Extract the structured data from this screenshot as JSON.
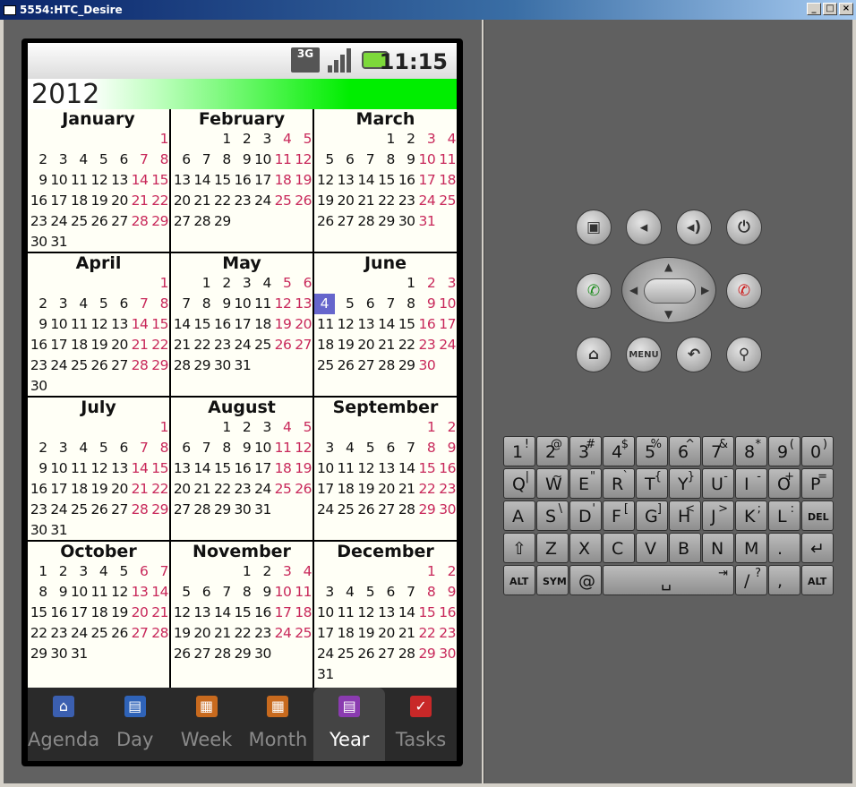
{
  "window": {
    "title": "5554:HTC_Desire",
    "buttons": [
      "_",
      "□",
      "×"
    ]
  },
  "status": {
    "network": "3G",
    "time": "11:15",
    "icons": [
      "3g-icon",
      "signal-icon",
      "battery-charging-icon"
    ]
  },
  "year": "2012",
  "months": [
    {
      "name": "January",
      "first": 6,
      "days": 31
    },
    {
      "name": "February",
      "first": 2,
      "days": 29
    },
    {
      "name": "March",
      "first": 3,
      "days": 31
    },
    {
      "name": "April",
      "first": 6,
      "days": 30
    },
    {
      "name": "May",
      "first": 1,
      "days": 31
    },
    {
      "name": "June",
      "first": 4,
      "days": 30,
      "today": 4
    },
    {
      "name": "July",
      "first": 6,
      "days": 31
    },
    {
      "name": "August",
      "first": 2,
      "days": 31
    },
    {
      "name": "September",
      "first": 5,
      "days": 30
    },
    {
      "name": "October",
      "first": 0,
      "days": 31
    },
    {
      "name": "November",
      "first": 3,
      "days": 30
    },
    {
      "name": "December",
      "first": 5,
      "days": 31
    }
  ],
  "colors": {
    "weekend": "#c8285a",
    "today_bg": "#6666cc",
    "year_bar": "#00ee00"
  },
  "tabs": [
    {
      "label": "Agenda",
      "icon": "agenda-icon",
      "selected": false
    },
    {
      "label": "Day",
      "icon": "day-icon",
      "selected": false
    },
    {
      "label": "Week",
      "icon": "week-icon",
      "selected": false
    },
    {
      "label": "Month",
      "icon": "month-icon",
      "selected": false
    },
    {
      "label": "Year",
      "icon": "year-icon",
      "selected": true
    },
    {
      "label": "Tasks",
      "icon": "tasks-icon",
      "selected": false
    }
  ],
  "hardware": {
    "menu_label": "MENU"
  },
  "keyboard": {
    "rows": [
      [
        [
          "1",
          "!"
        ],
        [
          "2",
          "@"
        ],
        [
          "3",
          "#"
        ],
        [
          "4",
          "$"
        ],
        [
          "5",
          "%"
        ],
        [
          "6",
          "^"
        ],
        [
          "7",
          "&"
        ],
        [
          "8",
          "*"
        ],
        [
          "9",
          "("
        ],
        [
          "0",
          ")"
        ]
      ],
      [
        [
          "Q",
          "|"
        ],
        [
          "W",
          "~"
        ],
        [
          "E",
          "\""
        ],
        [
          "R",
          "`"
        ],
        [
          "T",
          "{"
        ],
        [
          "Y",
          "}"
        ],
        [
          "U",
          "-"
        ],
        [
          "I",
          "-"
        ],
        [
          "O",
          "+"
        ],
        [
          "P",
          "="
        ]
      ],
      [
        [
          "A",
          ""
        ],
        [
          "S",
          "\\"
        ],
        [
          "D",
          "'"
        ],
        [
          "F",
          "["
        ],
        [
          "G",
          "]"
        ],
        [
          "H",
          "<"
        ],
        [
          "J",
          ">"
        ],
        [
          "K",
          ";"
        ],
        [
          "L",
          ":"
        ],
        [
          "DEL",
          ""
        ]
      ],
      [
        [
          "⇧",
          ""
        ],
        [
          "Z",
          ""
        ],
        [
          "X",
          ""
        ],
        [
          "C",
          ""
        ],
        [
          "V",
          ""
        ],
        [
          "B",
          ""
        ],
        [
          "N",
          ""
        ],
        [
          "M",
          ""
        ],
        [
          ".",
          ""
        ],
        [
          "↵",
          ""
        ]
      ],
      [
        [
          "ALT",
          ""
        ],
        [
          "SYM",
          ""
        ],
        [
          "@",
          ""
        ],
        [
          "␣",
          "⇥"
        ],
        [
          "/",
          "?"
        ],
        [
          ",",
          ""
        ],
        [
          "ALT",
          ""
        ]
      ]
    ]
  }
}
